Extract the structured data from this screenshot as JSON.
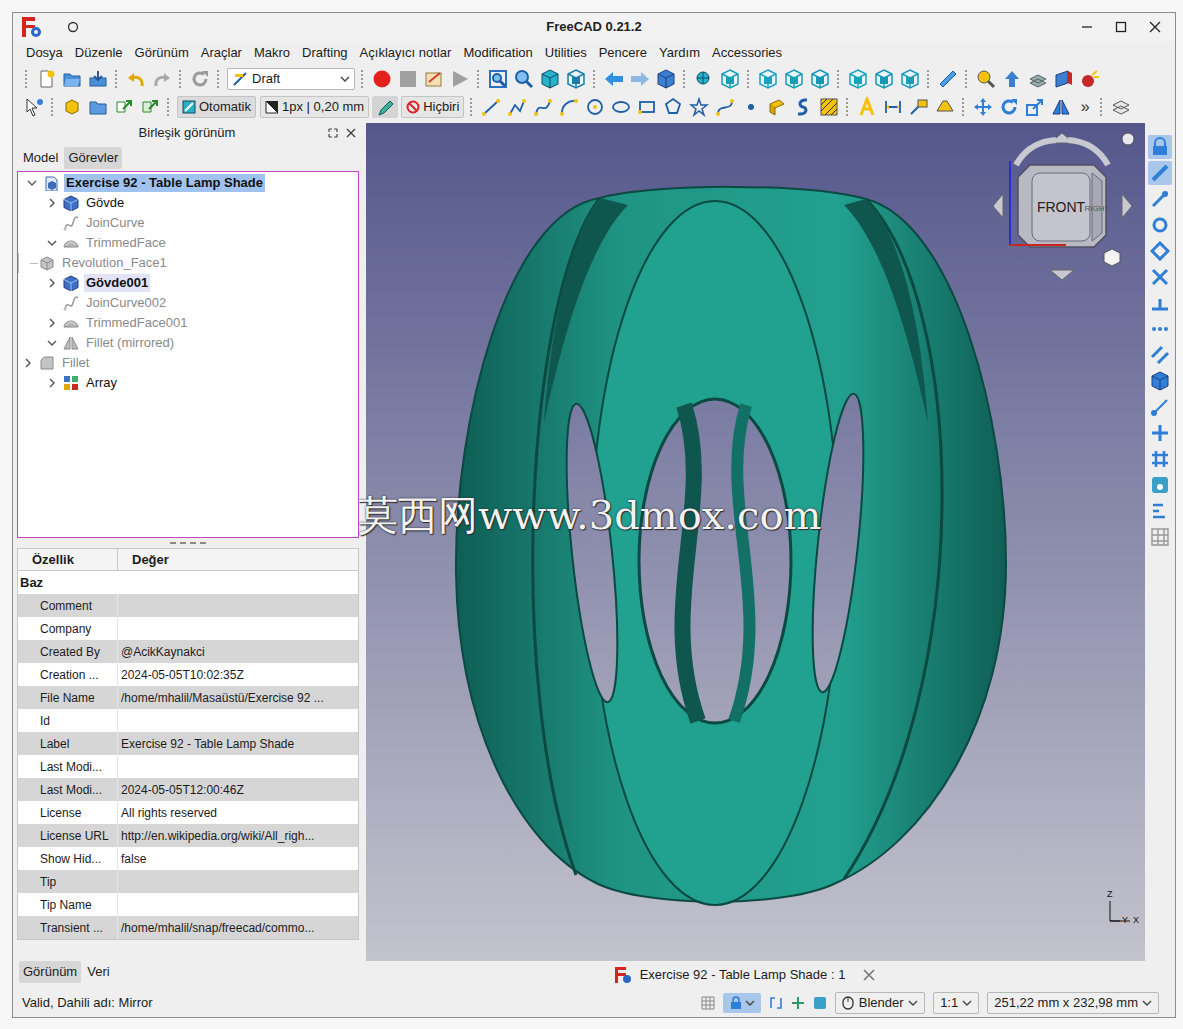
{
  "window": {
    "title": "FreeCAD 0.21.2"
  },
  "menu": [
    "Dosya",
    "Düzenle",
    "Görünüm",
    "Araçlar",
    "Makro",
    "Drafting",
    "Açıklayıcı notlar",
    "Modification",
    "Utilities",
    "Pencere",
    "Yardım",
    "Accessories"
  ],
  "toolbar": {
    "workbench": "Draft",
    "snap": "Otomatik",
    "line_style": "1px | 0,20 mm",
    "construction": "Hiçbiri",
    "overflow": "»"
  },
  "combo_view": {
    "title": "Birleşik görünüm",
    "tabs": [
      {
        "label": "Model",
        "selected": true
      },
      {
        "label": "Görevler",
        "selected": false
      }
    ]
  },
  "tree": [
    {
      "label": "Exercise 92 - Table Lamp Shade",
      "depth": 0,
      "kind": "document",
      "has_children": true,
      "expanded": true,
      "selected": true,
      "active": false,
      "greyed": false
    },
    {
      "label": "Gövde",
      "depth": 1,
      "kind": "body",
      "has_children": true,
      "expanded": false,
      "selected": false,
      "active": false,
      "greyed": false
    },
    {
      "label": "JoinCurve",
      "depth": 1,
      "kind": "curve",
      "has_children": false,
      "expanded": false,
      "selected": false,
      "active": false,
      "greyed": true
    },
    {
      "label": "TrimmedFace",
      "depth": 1,
      "kind": "surface",
      "has_children": true,
      "expanded": true,
      "selected": false,
      "active": false,
      "greyed": true
    },
    {
      "label": "Revolution_Face1",
      "depth": 2,
      "kind": "solid",
      "has_children": false,
      "expanded": false,
      "selected": false,
      "active": false,
      "greyed": true
    },
    {
      "label": "Gövde001",
      "depth": 1,
      "kind": "body",
      "has_children": true,
      "expanded": false,
      "selected": false,
      "active": true,
      "greyed": false
    },
    {
      "label": "JoinCurve002",
      "depth": 1,
      "kind": "curve",
      "has_children": false,
      "expanded": false,
      "selected": false,
      "active": false,
      "greyed": true
    },
    {
      "label": "TrimmedFace001",
      "depth": 1,
      "kind": "surface",
      "has_children": true,
      "expanded": false,
      "selected": false,
      "active": false,
      "greyed": true
    },
    {
      "label": "Fillet (mirrored)",
      "depth": 1,
      "kind": "mirror",
      "has_children": true,
      "expanded": true,
      "selected": false,
      "active": false,
      "greyed": true
    },
    {
      "label": "Fillet",
      "depth": 2,
      "kind": "fillet",
      "has_children": true,
      "expanded": false,
      "selected": false,
      "active": false,
      "greyed": true
    },
    {
      "label": "Array",
      "depth": 1,
      "kind": "array",
      "has_children": true,
      "expanded": false,
      "selected": false,
      "active": false,
      "greyed": false
    }
  ],
  "properties": {
    "columns": [
      "Özellik",
      "Değer"
    ],
    "group": "Baz",
    "rows": [
      [
        "Comment",
        ""
      ],
      [
        "Company",
        ""
      ],
      [
        "Created By",
        "@AcikKaynakci"
      ],
      [
        "Creation ...",
        "2024-05-05T10:02:35Z"
      ],
      [
        "File Name",
        "/home/mhalil/Masaüstü/Exercise 92 ..."
      ],
      [
        "Id",
        ""
      ],
      [
        "Label",
        "Exercise 92 - Table Lamp Shade"
      ],
      [
        "Last Modi...",
        ""
      ],
      [
        "Last Modi...",
        "2024-05-05T12:00:46Z"
      ],
      [
        "License",
        "All rights reserved"
      ],
      [
        "License URL",
        "http://en.wikipedia.org/wiki/All_righ..."
      ],
      [
        "Show Hid...",
        "false"
      ],
      [
        "Tip",
        ""
      ],
      [
        "Tip Name",
        ""
      ],
      [
        "Transient ...",
        "/home/mhalil/snap/freecad/commo..."
      ]
    ]
  },
  "property_tabs": [
    {
      "label": "Görünüm",
      "selected": false
    },
    {
      "label": "Veri",
      "selected": true
    }
  ],
  "view": {
    "watermark": "莫西网www.3dmox.com",
    "navcube_front": "FRONT",
    "navcube_right": "RIGHT",
    "axes": [
      "Z",
      "Y",
      "X"
    ]
  },
  "right_toolbar": [
    {
      "active": true
    },
    {
      "active": true
    },
    {
      "active": false
    },
    {
      "active": false
    },
    {
      "active": false
    },
    {
      "active": false
    },
    {
      "active": false
    },
    {
      "active": false
    },
    {
      "active": false
    },
    {
      "active": false
    },
    {
      "active": false
    },
    {
      "active": false
    },
    {
      "active": false
    },
    {
      "active": false
    },
    {
      "active": false
    },
    {
      "active": false
    }
  ],
  "document_tabs": [
    {
      "label": "Exercise 92 - Table Lamp Shade : 1",
      "selected": true
    }
  ],
  "status_bar": {
    "message": "Valid, Dahili adı: Mirror",
    "navigation": "Blender",
    "zoom": "1:1",
    "dimensions": "251,22 mm x 232,98 mm"
  }
}
